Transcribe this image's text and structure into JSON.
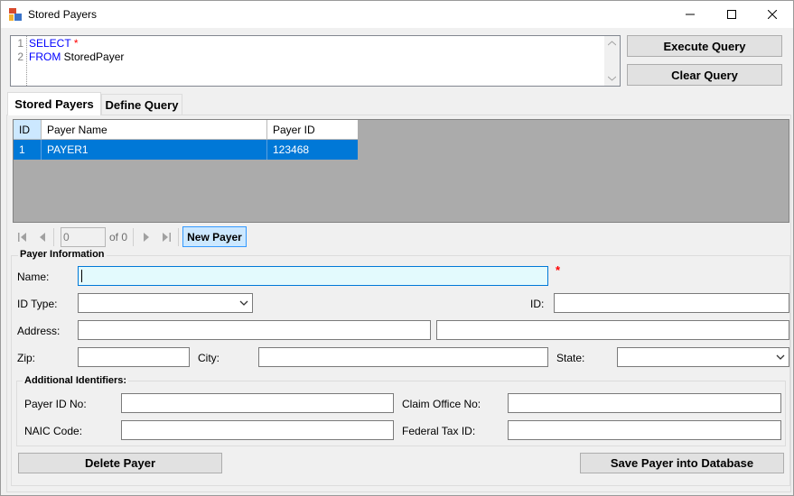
{
  "window": {
    "title": "Stored Payers"
  },
  "query": {
    "line_numbers": [
      "1",
      "2"
    ],
    "line1_keyword": "SELECT",
    "line1_symbol": "*",
    "line2_keyword": "FROM",
    "line2_table": "StoredPayer",
    "execute_label": "Execute Query",
    "clear_label": "Clear Query"
  },
  "tabs": [
    {
      "label": "Stored Payers",
      "active": true
    },
    {
      "label": "Define Query",
      "active": false
    }
  ],
  "grid": {
    "columns": [
      "ID",
      "Payer Name",
      "Payer ID"
    ],
    "rows": [
      {
        "id": "1",
        "payer_name": "PAYER1",
        "payer_id": "123468",
        "selected": true
      }
    ]
  },
  "navigator": {
    "position": "0",
    "of_label": "of 0",
    "new_payer_label": "New Payer"
  },
  "payer_info": {
    "title": "Payer Information",
    "name_label": "Name:",
    "name_value": "",
    "required_mark": "*",
    "id_type_label": "ID Type:",
    "id_type_value": "",
    "id_label": "ID:",
    "id_value": "",
    "address_label": "Address:",
    "address1_value": "",
    "address2_value": "",
    "zip_label": "Zip:",
    "zip_value": "",
    "city_label": "City:",
    "city_value": "",
    "state_label": "State:",
    "state_value": ""
  },
  "additional": {
    "title": "Additional Identifiers:",
    "payer_id_no_label": "Payer ID No:",
    "claim_office_label": "Claim Office No:",
    "naic_label": "NAIC Code:",
    "federal_tax_label": "Federal Tax ID:",
    "payer_id_no_value": "",
    "claim_office_value": "",
    "naic_value": "",
    "federal_tax_value": ""
  },
  "actions": {
    "delete_label": "Delete Payer",
    "save_label": "Save Payer into Database"
  },
  "colors": {
    "selection": "#0078d7",
    "grid_background": "#ababab",
    "keyword": "#0000ff",
    "required": "#ff0000",
    "focused_input": "#e3fafd"
  }
}
